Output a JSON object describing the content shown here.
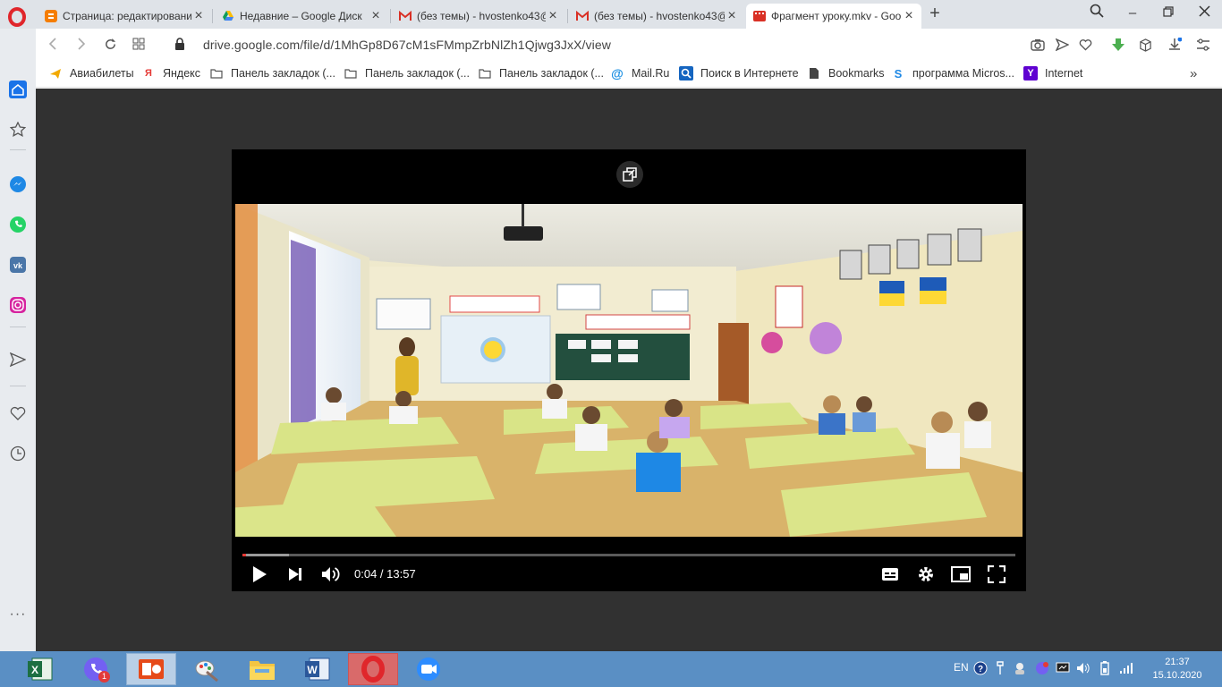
{
  "browser": {
    "tabs": [
      {
        "title": "Страница: редактировани",
        "favicon": "blogger-icon",
        "active": false
      },
      {
        "title": "Недавние – Google Диск",
        "favicon": "google-drive-icon",
        "active": false
      },
      {
        "title": "(без темы) - hvostenko43@",
        "favicon": "gmail-icon",
        "active": false
      },
      {
        "title": "(без темы) - hvostenko43@",
        "favicon": "gmail-icon",
        "active": false
      },
      {
        "title": "Фрагмент уроку.mkv - Goo",
        "favicon": "video-file-icon",
        "active": true
      }
    ],
    "url": "drive.google.com/file/d/1MhGp8D67cM1sFMmpZrbNlZh1Qjwg3JxX/view",
    "bookmarks": [
      {
        "label": "Авиабилеты",
        "icon": "plane-icon"
      },
      {
        "label": "Яндекс",
        "icon": "yandex-icon"
      },
      {
        "label": "Панель закладок (...",
        "icon": "folder-icon"
      },
      {
        "label": "Панель закладок (...",
        "icon": "folder-icon"
      },
      {
        "label": "Панель закладок (...",
        "icon": "folder-icon"
      },
      {
        "label": "Mail.Ru",
        "icon": "mailru-icon"
      },
      {
        "label": "Поиск в Интернете",
        "icon": "search-icon"
      },
      {
        "label": "Bookmarks",
        "icon": "page-icon"
      },
      {
        "label": "программа Micros...",
        "icon": "skype-icon"
      },
      {
        "label": "Internet",
        "icon": "yahoo-icon"
      }
    ]
  },
  "player": {
    "current_time": "0:04",
    "duration": "13:57",
    "time_display": "0:04 / 13:57",
    "progress_fraction": 0.005,
    "buffered_fraction": 0.06
  },
  "taskbar": {
    "apps": [
      "excel-icon",
      "viber-icon",
      "presentation-icon",
      "paint-icon",
      "file-explorer-icon",
      "word-icon",
      "opera-icon",
      "zoom-icon"
    ],
    "viber_badge": "1",
    "language": "EN",
    "time": "21:37",
    "date": "15.10.2020"
  },
  "colors": {
    "tab_strip": "#dfe3e8",
    "player_bg": "#000000",
    "page_bg": "#313131",
    "progress": "#e53935",
    "taskbar": "#5a8fc4"
  }
}
